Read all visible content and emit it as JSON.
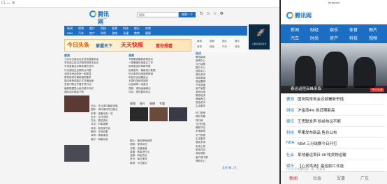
{
  "desktop": {
    "window_controls": "☐ — ✕",
    "logo_text": "腾讯网",
    "logo_sub": "QQ.COM",
    "search_placeholder": "搜狗",
    "search_button": "搜索一下",
    "nav": [
      "新闻",
      "视频",
      "图片",
      "财经",
      "股票",
      "科技",
      "娱乐",
      "体育",
      "NBA",
      "汽车",
      "房产",
      "时尚",
      "游戏",
      "动漫",
      "教育",
      "健康"
    ],
    "banner": {
      "left": "今日头条",
      "mid": "掌握天下",
      "right": "天天快报",
      "tail": "看你想看"
    },
    "rocket_caption": "火箭队最新资讯",
    "quick_links": [
      "新闻",
      "视频",
      "图片",
      "娱乐",
      "体育",
      "财经",
      "汽车",
      "科技"
    ],
    "heads": {
      "news": "要闻",
      "center": "视频",
      "right": "热点"
    },
    "news_list": [
      "习近平出席会议并发表重要讲话",
      "李克强主持召开国务院常务会议",
      "中央重要会议释放哪些信号",
      "外交部回应近期热点问题",
      "全国多地迎来新一轮降温",
      "教育部发布最新通知要求",
      "国内首条线路正式开通运营",
      "多部门联合开展专项行动",
      "最新数据显示经济稳中向好",
      "国际油价继续下跌"
    ],
    "center_list": [
      "专家解读最新政策走向",
      "一图看懂年度重点工作",
      "各地推进改革新举措",
      "权威发布：最新统计数据",
      "热点事件持续追踪报道",
      "网友热议话题盘点",
      "本周科技新闻回顾",
      "社会新闻一线直击",
      "视频：现场画面曝光",
      "评论：理性看待热点"
    ],
    "right_list": [
      "腾讯新闻",
      "新闻中心",
      "今日话题",
      "图片中心",
      "视频中心",
      "娱乐资讯",
      "体育赛事",
      "财经要闻",
      "汽车频道",
      "房产家居",
      "游戏动漫",
      "教育培训",
      "健康养生",
      "旅游资讯",
      "生活服务"
    ],
    "tabs2": [
      "视频",
      "图片",
      "直播",
      "专题"
    ],
    "bottom_list": [
      "社会：热点事件最新进展",
      "国际：海外媒体关注焦点",
      "军事：装备动态一览",
      "历史：今日回顾",
      "文化：展览资讯",
      "评论：时事观察",
      "科技：新品发布会",
      "数码：评测合集",
      "体育：赛事速递",
      "娱乐：明星动态"
    ],
    "c2_list": [
      "图片：精彩瞬间回顾",
      "视频：现场实拍",
      "专题：深度报道",
      "直播：赛事进行中",
      "话题：网友热议",
      "资讯：每日速览",
      "新闻：今日要点"
    ],
    "r2_list": [
      "热门推荐",
      "精彩专题",
      "排行榜",
      "今日热搜",
      "最新评论",
      "本地新闻",
      "天气预报",
      "生活服务",
      "便民查询",
      "实用工具",
      "更多内容",
      "网站导航",
      "客户端下载",
      "帮助中心",
      "意见反馈",
      "联系我们"
    ],
    "weather": "北京 晴 -2℃"
  },
  "phone": {
    "status": "xw.qq.com",
    "logo_text": "腾讯网",
    "nav": [
      "新闻",
      "财经",
      "娱乐",
      "体育",
      "图片",
      "汽车",
      "时尚",
      "房产",
      "科技",
      "视频",
      "游戏",
      "更多"
    ],
    "hero_caption": "春运返程高峰来临",
    "hero_tag": "今日头条",
    "items": [
      {
        "src": "要闻",
        "title": "国务院常务会议部署新举措"
      },
      {
        "src": "财经",
        "title": "沪指涨4% 创近期新高"
      },
      {
        "src": "娱乐",
        "title": "王思聪发声 粉丝热议不断"
      },
      {
        "src": "科技",
        "title": "苹果发布新品 售价公布"
      },
      {
        "src": "NBA",
        "title": "NBA 三分球赛今日开打"
      },
      {
        "src": "社会",
        "title": "某地春运首日 68 吨货物运输"
      },
      {
        "src": "娱乐",
        "title": "【心灵鸡汤】最佳影片评选"
      }
    ],
    "footer_hint": "PGOC手机腾讯网 · 新一代资讯",
    "bottom_nav": [
      "新闻",
      "社会",
      "军事",
      "广东"
    ]
  }
}
